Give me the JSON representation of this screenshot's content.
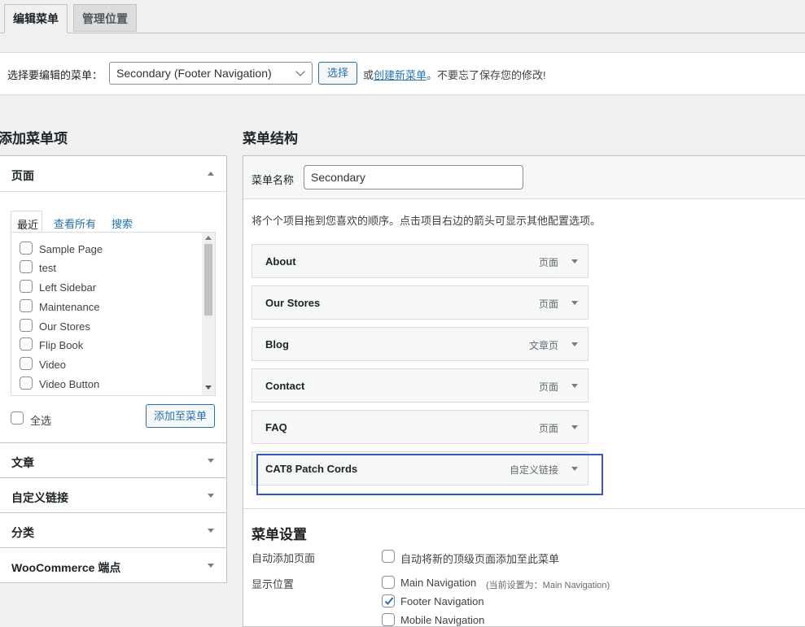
{
  "tabs": {
    "edit": "编辑菜单",
    "manage": "管理位置"
  },
  "select_bar": {
    "label": "选择要编辑的菜单：",
    "selected_menu": "Secondary (Footer Navigation)",
    "select_button": "选择",
    "or_text": "或",
    "create_link": "创建新菜单",
    "reminder": "。不要忘了保存您的修改!"
  },
  "left": {
    "title": "添加菜单项",
    "pages": {
      "title": "页面",
      "tabs": [
        "最近",
        "查看所有",
        "搜索"
      ],
      "items": [
        "Sample Page",
        "test",
        "Left Sidebar",
        "Maintenance",
        "Our Stores",
        "Flip Book",
        "Video",
        "Video Button"
      ],
      "select_all": "全选",
      "add_button": "添加至菜单"
    },
    "sections": [
      "文章",
      "自定义链接",
      "分类",
      "WooCommerce 端点"
    ]
  },
  "right": {
    "title": "菜单结构",
    "name_label": "菜单名称",
    "name_value": "Secondary",
    "instructions": "将个个项目拖到您喜欢的顺序。点击项目右边的箭头可显示其他配置选项。",
    "items": [
      {
        "title": "About",
        "type": "页面"
      },
      {
        "title": "Our Stores",
        "type": "页面"
      },
      {
        "title": "Blog",
        "type": "文章页"
      },
      {
        "title": "Contact",
        "type": "页面"
      },
      {
        "title": "FAQ",
        "type": "页面"
      },
      {
        "title": "CAT8 Patch Cords",
        "type": "自定义链接"
      }
    ],
    "settings": {
      "title": "菜单设置",
      "auto_add_label": "自动添加页面",
      "auto_add_option": "自动将新的顶级页面添加至此菜单",
      "locations_label": "显示位置",
      "locations": [
        {
          "name": "Main Navigation",
          "note": "(当前设置为：Main Navigation)",
          "checked": false
        },
        {
          "name": "Footer Navigation",
          "note": "",
          "checked": true
        },
        {
          "name": "Mobile Navigation",
          "note": "",
          "checked": false
        }
      ]
    }
  },
  "colors": {
    "link": "#2271b1",
    "highlight_box": "#3456c8"
  }
}
